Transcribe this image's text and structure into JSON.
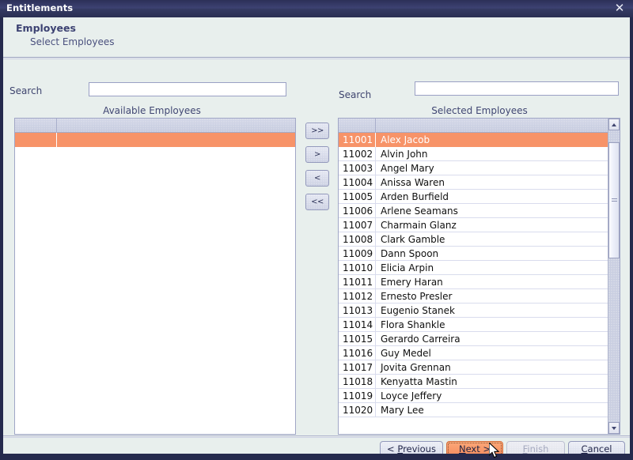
{
  "window": {
    "title": "Entitlements",
    "close_icon": "close-icon"
  },
  "banner": {
    "title": "Employees",
    "subtitle": "Select Employees"
  },
  "available_panel": {
    "search_label": "Search",
    "search_value": "",
    "search_placeholder": "",
    "caption": "Available Employees",
    "columns": [
      "",
      ""
    ],
    "rows": [],
    "selected_blank_row": true
  },
  "selected_panel": {
    "search_label": "Search",
    "search_value": "",
    "search_placeholder": "",
    "caption": "Selected Employees",
    "columns": [
      "",
      ""
    ],
    "selected_index": 0,
    "rows": [
      {
        "id": "11001",
        "name": "Alex Jacob"
      },
      {
        "id": "11002",
        "name": "Alvin John"
      },
      {
        "id": "11003",
        "name": "Angel Mary"
      },
      {
        "id": "11004",
        "name": "Anissa Waren"
      },
      {
        "id": "11005",
        "name": "Arden Burfield"
      },
      {
        "id": "11006",
        "name": "Arlene Seamans"
      },
      {
        "id": "11007",
        "name": "Charmain Glanz"
      },
      {
        "id": "11008",
        "name": "Clark Gamble"
      },
      {
        "id": "11009",
        "name": "Dann Spoon"
      },
      {
        "id": "11010",
        "name": "Elicia Arpin"
      },
      {
        "id": "11011",
        "name": "Emery Haran"
      },
      {
        "id": "11012",
        "name": "Ernesto Presler"
      },
      {
        "id": "11013",
        "name": "Eugenio Stanek"
      },
      {
        "id": "11014",
        "name": "Flora Shankle"
      },
      {
        "id": "11015",
        "name": "Gerardo Carreira"
      },
      {
        "id": "11016",
        "name": "Guy Medel"
      },
      {
        "id": "11017",
        "name": "Jovita Grennan"
      },
      {
        "id": "11018",
        "name": "Kenyatta Mastin"
      },
      {
        "id": "11019",
        "name": "Loyce Jeffery"
      },
      {
        "id": "11020",
        "name": "Mary Lee"
      }
    ],
    "scrollbar": {
      "up_icon": "scroll-up-arrow-icon",
      "down_icon": "scroll-down-arrow-icon",
      "thumb_top_pct": 4,
      "thumb_height_pct": 40
    }
  },
  "transfer_buttons": [
    {
      "name": "move-all-right-button",
      "label": ">>"
    },
    {
      "name": "move-right-button",
      "label": ">"
    },
    {
      "name": "move-left-button",
      "label": "<"
    },
    {
      "name": "move-all-left-button",
      "label": "<<"
    }
  ],
  "footer_buttons": {
    "previous": {
      "prefix": "< ",
      "mnemonic": "P",
      "rest": "revious"
    },
    "next": {
      "prefix": "",
      "mnemonic": "N",
      "rest": "ext >"
    },
    "finish": {
      "prefix": "",
      "mnemonic": "F",
      "rest": "inish",
      "disabled": true
    },
    "cancel": {
      "prefix": "",
      "mnemonic": "C",
      "rest": "ancel"
    }
  },
  "colors": {
    "titlebar": "#343a63",
    "panel_bg": "#e8efed",
    "selection_orange": "#f79368",
    "accent_text": "#3c4272",
    "border_navy": "#252a4d"
  }
}
